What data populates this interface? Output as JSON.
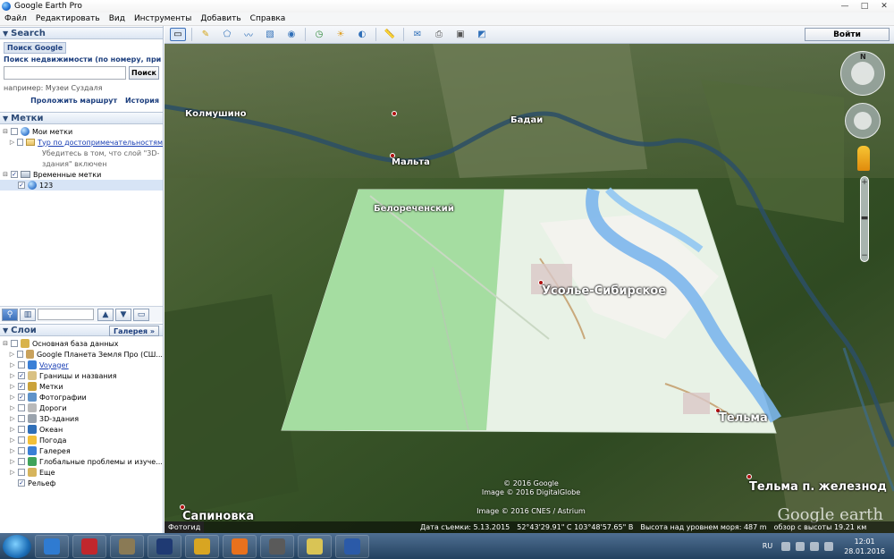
{
  "window": {
    "title": "Google Earth Pro",
    "controls": [
      "—",
      "□",
      "✕"
    ]
  },
  "menu": [
    "Файл",
    "Редактировать",
    "Вид",
    "Инструменты",
    "Добавить",
    "Справка"
  ],
  "search": {
    "header": "Search",
    "tab": "Поиск Google",
    "hint_top": "Поиск недвижимости (по номеру, присвоен",
    "button": "Поиск",
    "example": "например: Музеи Суздаля",
    "link_route": "Проложить маршрут",
    "link_history": "История"
  },
  "places": {
    "header": "Метки",
    "items": [
      {
        "label": "Мои метки"
      },
      {
        "label": "Тур по достопримечательностям"
      },
      {
        "label": "Убедитесь в том, что слой \"3D-"
      },
      {
        "label": "здания\" включен"
      },
      {
        "label": "Временные метки"
      },
      {
        "label": "123"
      }
    ]
  },
  "layers": {
    "header": "Слои",
    "gallery_button": "Галерея »",
    "items": [
      {
        "label": "Основная база данных",
        "color": "#d8b34a"
      },
      {
        "label": "Google Планета Земля Про (СШ...",
        "color": "#c9a25c"
      },
      {
        "label": "Voyager",
        "color": "#3a7fd6"
      },
      {
        "label": "Границы и названия",
        "color": "#d9c183"
      },
      {
        "label": "Метки",
        "color": "#caa23a"
      },
      {
        "label": "Фотографии",
        "color": "#5f93c9"
      },
      {
        "label": "Дороги",
        "color": "#b9b9b9"
      },
      {
        "label": "3D-здания",
        "color": "#9aa3ad"
      },
      {
        "label": "Океан",
        "color": "#2f6fb8"
      },
      {
        "label": "Погода",
        "color": "#f2c03a"
      },
      {
        "label": "Галерея",
        "color": "#3a7fd6"
      },
      {
        "label": "Глобальные проблемы и изуче...",
        "color": "#3fa35a"
      },
      {
        "label": "Еще",
        "color": "#d6b45c"
      },
      {
        "label": "Рельеф",
        "color": "#6b8e4e"
      }
    ]
  },
  "toolbar": {
    "login": "Войти"
  },
  "map": {
    "places": [
      {
        "name": "Колмушино"
      },
      {
        "name": "Бадаи"
      },
      {
        "name": "Мальта"
      },
      {
        "name": "Белореченский"
      },
      {
        "name": "Усолье-Сибирское"
      },
      {
        "name": "Тельма"
      },
      {
        "name": "Тельма п. железнод"
      },
      {
        "name": "Сапиновка"
      }
    ],
    "credits": [
      "© 2016 Google",
      "Image © 2016 DigitalGlobe",
      "Image © 2016 CNES / Astrium"
    ],
    "watermark": "Google earth",
    "photo_tag": "Фотогид",
    "status": {
      "date": "Дата съемки: 5.13.2015",
      "coords": "52°43'29.91\" С  103°48'57.65\" В",
      "elevation": "Высота над уровнем моря:   487 m",
      "eye": "обзор с высоты   19.21 км"
    },
    "compass_n": "N"
  },
  "taskbar": {
    "lang": "RU",
    "time": "12:01",
    "date": "28.01.2016",
    "apps": [
      {
        "name": "google-earth",
        "color": "#2f7bd1"
      },
      {
        "name": "filezilla",
        "color": "#c1272d"
      },
      {
        "name": "globe",
        "color": "#8a7a55"
      },
      {
        "name": "photoshop",
        "color": "#1f3a73"
      },
      {
        "name": "tool",
        "color": "#d8a522"
      },
      {
        "name": "firefox",
        "color": "#e8711d"
      },
      {
        "name": "tanks",
        "color": "#5a5a5a"
      },
      {
        "name": "files",
        "color": "#d9c455"
      },
      {
        "name": "word",
        "color": "#2b5aa8"
      }
    ]
  }
}
